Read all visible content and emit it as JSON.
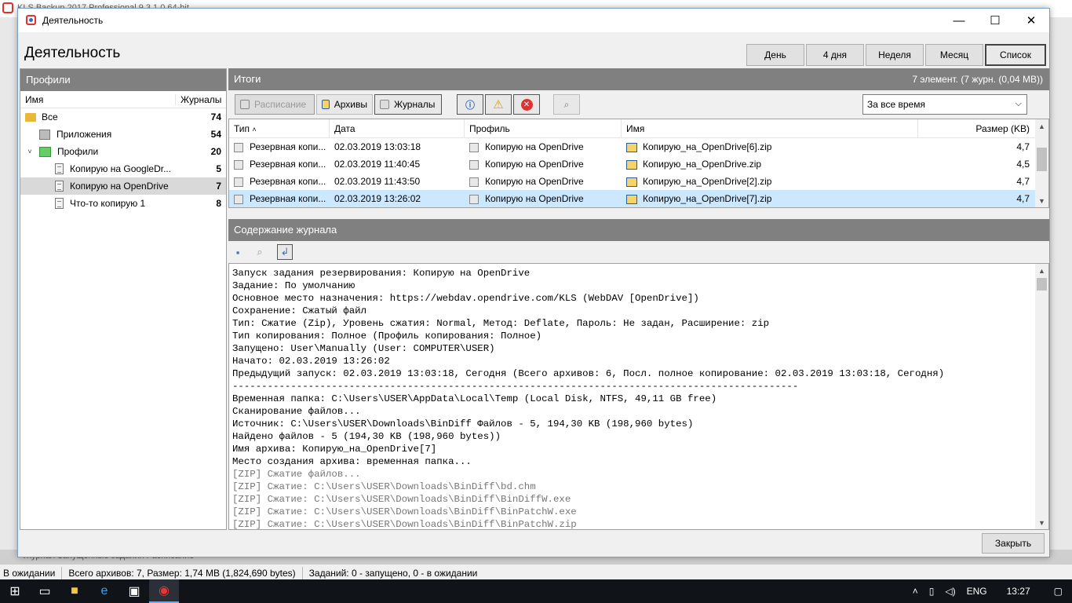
{
  "background_app": {
    "title": "KLS Backup 2017 Professional 9.3.1.0 64-bit",
    "bottom_tabs": "Журнал   Запущенные задания   Расписание"
  },
  "statusbar": {
    "state": "В ожидании",
    "archives": "Всего архивов: 7, Размер: 1,74 MB (1,824,690 bytes)",
    "tasks": "Заданий: 0 - запущено, 0 - в ожидании"
  },
  "taskbar": {
    "lang": "ENG",
    "time": "13:27"
  },
  "dialog": {
    "title": "Деятельность",
    "heading": "Деятельность",
    "range_buttons": [
      "День",
      "4 дня",
      "Неделя",
      "Месяц",
      "Список"
    ],
    "selected_range": "Список",
    "close_label": "Закрыть"
  },
  "profiles": {
    "header": "Профили",
    "col_name": "Имя",
    "col_logs": "Журналы",
    "rows": [
      {
        "label": "Все",
        "count": "74"
      },
      {
        "label": "Приложения",
        "count": "54"
      },
      {
        "label": "Профили",
        "count": "20"
      },
      {
        "label": "Копирую на GoogleDr...",
        "count": "5"
      },
      {
        "label": "Копирую на OpenDrive",
        "count": "7"
      },
      {
        "label": "Что-то копирую 1",
        "count": "8"
      }
    ]
  },
  "results": {
    "header": "Итоги",
    "count": "7 элемент. (7 журн. (0,04 MB))",
    "toolbar": {
      "schedule": "Расписание",
      "archives": "Архивы",
      "logs": "Журналы"
    },
    "period": "За все время",
    "columns": [
      "Тип",
      "Дата",
      "Профиль",
      "Имя",
      "Размер (KB)"
    ],
    "rows": [
      {
        "type": "Резервная копи...",
        "date": "02.03.2019 13:03:18",
        "profile": "Копирую на OpenDrive",
        "name": "Копирую_на_OpenDrive[6].zip",
        "size": "4,7"
      },
      {
        "type": "Резервная копи...",
        "date": "02.03.2019 11:40:45",
        "profile": "Копирую на OpenDrive",
        "name": "Копирую_на_OpenDrive.zip",
        "size": "4,5"
      },
      {
        "type": "Резервная копи...",
        "date": "02.03.2019 11:43:50",
        "profile": "Копирую на OpenDrive",
        "name": "Копирую_на_OpenDrive[2].zip",
        "size": "4,7"
      },
      {
        "type": "Резервная копи...",
        "date": "02.03.2019 13:26:02",
        "profile": "Копирую на OpenDrive",
        "name": "Копирую_на_OpenDrive[7].zip",
        "size": "4,7"
      }
    ]
  },
  "journal": {
    "header": "Содержание журнала",
    "lines": [
      "Запуск задания резервирования: Копирую на OpenDrive",
      "Задание: По умолчанию",
      "Основное место назначения: https://webdav.opendrive.com/KLS (WebDAV [OpenDrive])",
      "Сохранение: Сжатый файл",
      "Тип: Сжатие (Zip), Уровень сжатия: Normal, Метод: Deflate, Пароль: Не задан, Расширение: zip",
      "Тип копирования: Полное (Профиль копирования: Полное)",
      "Запущено: User\\Manually (User: COMPUTER\\USER)",
      "Начато: 02.03.2019 13:26:02",
      "Предыдущий запуск: 02.03.2019 13:03:18, Сегодня (Всего архивов: 6, Посл. полное копирование: 02.03.2019 13:03:18, Сегодня)",
      "-------------------------------------------------------------------------------------------------",
      "Временная папка: C:\\Users\\USER\\AppData\\Local\\Temp (Local Disk, NTFS, 49,11 GB free)",
      "Сканирование файлов...",
      "Источник: C:\\Users\\USER\\Downloads\\BinDiff Файлов - 5, 194,30 KB (198,960 bytes)",
      "Найдено файлов - 5 (194,30 KB (198,960 bytes))",
      "Имя архива: Копирую_на_OpenDrive[7]",
      "Место создания архива: временная папка..."
    ],
    "grey_lines": [
      "[ZIP] Сжатие файлов...",
      "[ZIP] Сжатие: C:\\Users\\USER\\Downloads\\BinDiff\\bd.chm",
      "[ZIP] Сжатие: C:\\Users\\USER\\Downloads\\BinDiff\\BinDiffW.exe",
      "[ZIP] Сжатие: C:\\Users\\USER\\Downloads\\BinDiff\\BinPatchW.exe",
      "[ZIP] Сжатие: C:\\Users\\USER\\Downloads\\BinDiff\\BinPatchW.zip"
    ]
  }
}
